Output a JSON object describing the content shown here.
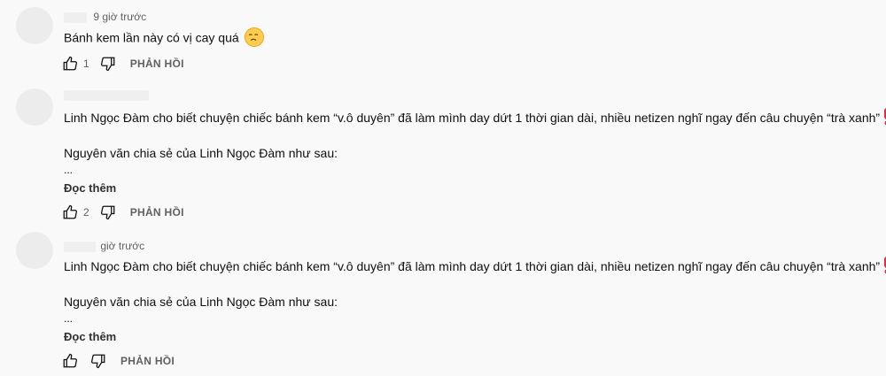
{
  "comments": [
    {
      "timestamp": "9 giờ trước",
      "text": "Bánh kem lần này có vị cay quá",
      "emoji": "disappointed-face",
      "likes": "1",
      "reply": "PHẢN HỒI"
    },
    {
      "timestamp": "",
      "text": "Linh Ngọc Đàm cho biết chuyện chiếc bánh kem “v.ô duyên” đã làm mình day dứt 1 thời gian dài, nhiều netizen nghĩ ngay đến câu chuyện “trà xanh”",
      "quote": "Nguyên văn chia sẻ của Linh Ngọc Đàm như sau:",
      "ellipsis": "...",
      "read_more": "Đọc thêm",
      "likes": "2",
      "reply": "PHẢN HỒI"
    },
    {
      "timestamp": "giờ trước",
      "text": "Linh Ngọc Đàm cho biết chuyện chiếc bánh kem “v.ô duyên” đã làm mình day dứt 1 thời gian dài, nhiều netizen nghĩ ngay đến câu chuyện “trà xanh”",
      "quote": "Nguyên văn chia sẻ của Linh Ngọc Đàm như sau:",
      "ellipsis": "...",
      "read_more": "Đọc thêm",
      "likes": "",
      "reply": "PHẢN HỒI"
    }
  ],
  "colors": {
    "exclamation": "#dd2e44",
    "emoji": "#ffcc4d"
  },
  "icons": {
    "like": "thumb-up-icon",
    "dislike": "thumb-down-icon",
    "exclamation": "red-exclamation-icon"
  }
}
